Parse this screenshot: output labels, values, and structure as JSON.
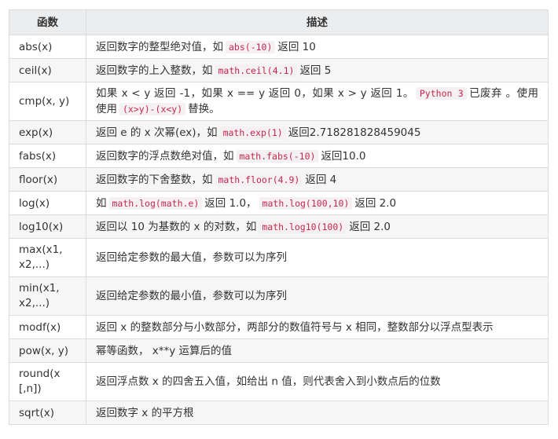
{
  "table": {
    "headers": [
      "函数",
      "描述"
    ],
    "rows": [
      {
        "name": "abs(x)",
        "parts": [
          {
            "text": "返回数字的整型绝对值，如"
          },
          {
            "code": "abs(-10)"
          },
          {
            "text": "返回 10"
          }
        ]
      },
      {
        "name": "ceil(x)",
        "parts": [
          {
            "text": "返回数字的上入整数，如"
          },
          {
            "code": "math.ceil(4.1)"
          },
          {
            "text": "返回 5"
          }
        ]
      },
      {
        "name": "cmp(x, y)",
        "parts": [
          {
            "text": "如果 x < y 返回 -1，如果 x == y 返回 0，如果 x > y 返回 1。"
          },
          {
            "code": "Python 3"
          },
          {
            "text": "已废弃 。使用 使用"
          },
          {
            "code": "(x>y)-(x<y)"
          },
          {
            "text": "替换。"
          }
        ]
      },
      {
        "name": "exp(x)",
        "parts": [
          {
            "text": "返回 e 的 x 次幂(ex)，如"
          },
          {
            "code": "math.exp(1)"
          },
          {
            "text": "返回2.718281828459045"
          }
        ]
      },
      {
        "name": "fabs(x)",
        "parts": [
          {
            "text": "返回数字的浮点数绝对值，如"
          },
          {
            "code": "math.fabs(-10)"
          },
          {
            "text": "返回10.0"
          }
        ]
      },
      {
        "name": "floor(x)",
        "parts": [
          {
            "text": "返回数字的下舍整数，如"
          },
          {
            "code": "math.floor(4.9)"
          },
          {
            "text": "返回 4"
          }
        ]
      },
      {
        "name": "log(x)",
        "parts": [
          {
            "text": "如"
          },
          {
            "code": "math.log(math.e)"
          },
          {
            "text": "返回 1.0，"
          },
          {
            "code": "math.log(100,10)"
          },
          {
            "text": "返回 2.0"
          }
        ]
      },
      {
        "name": "log10(x)",
        "parts": [
          {
            "text": "返回以 10 为基数的 x 的对数，如"
          },
          {
            "code": "math.log10(100)"
          },
          {
            "text": "返回 2.0"
          }
        ]
      },
      {
        "name": "max(x1, x2,...)",
        "parts": [
          {
            "text": "返回给定参数的最大值，参数可以为序列"
          }
        ]
      },
      {
        "name": "min(x1, x2,...)",
        "parts": [
          {
            "text": "返回给定参数的最小值，参数可以为序列"
          }
        ]
      },
      {
        "name": "modf(x)",
        "parts": [
          {
            "text": "返回 x 的整数部分与小数部分，两部分的数值符号与 x 相同，整数部分以浮点型表示"
          }
        ]
      },
      {
        "name": "pow(x, y)",
        "parts": [
          {
            "text": "幂等函数， x**y 运算后的值"
          }
        ]
      },
      {
        "name": "round(x [,n])",
        "parts": [
          {
            "text": "返回浮点数 x 的四舍五入值，如给出 n 值，则代表舍入到小数点后的位数"
          }
        ]
      },
      {
        "name": "sqrt(x)",
        "parts": [
          {
            "text": "返回数字 x 的平方根"
          }
        ]
      }
    ]
  }
}
